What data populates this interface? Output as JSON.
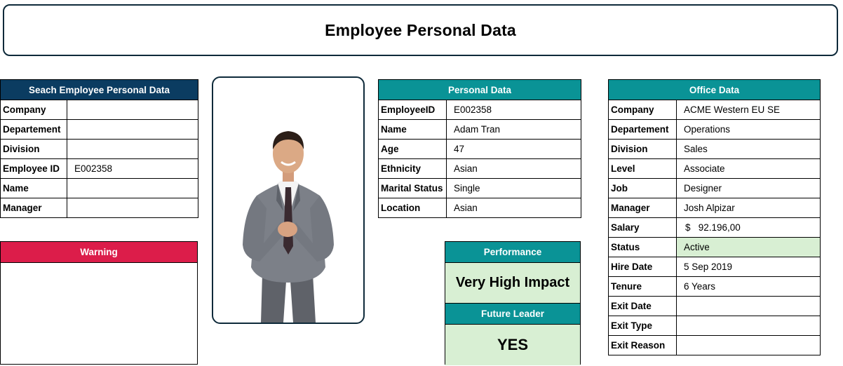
{
  "page_title": "Employee Personal Data",
  "search": {
    "header": "Seach Employee Personal Data",
    "rows": [
      {
        "label": "Company",
        "value": ""
      },
      {
        "label": "Departement",
        "value": ""
      },
      {
        "label": "Division",
        "value": ""
      },
      {
        "label": "Employee ID",
        "value": "E002358"
      },
      {
        "label": "Name",
        "value": ""
      },
      {
        "label": "Manager",
        "value": ""
      }
    ]
  },
  "warning": {
    "header": "Warning",
    "text": ""
  },
  "photo": {
    "icon": "employee-photo"
  },
  "personal": {
    "header": "Personal Data",
    "rows": [
      {
        "label": "EmployeeID",
        "value": "E002358"
      },
      {
        "label": "Name",
        "value": "Adam Tran"
      },
      {
        "label": "Age",
        "value": "47"
      },
      {
        "label": "Ethnicity",
        "value": "Asian"
      },
      {
        "label": "Marital Status",
        "value": "Single"
      },
      {
        "label": "Location",
        "value": "Asian"
      }
    ]
  },
  "performance": {
    "header": "Performance",
    "value": "Very High Impact"
  },
  "future_leader": {
    "header": "Future Leader",
    "value": "YES"
  },
  "office": {
    "header": "Office Data",
    "rows": [
      {
        "label": "Company",
        "value": "ACME Western EU SE"
      },
      {
        "label": "Departement",
        "value": "Operations"
      },
      {
        "label": "Division",
        "value": "Sales"
      },
      {
        "label": "Level",
        "value": "Associate"
      },
      {
        "label": "Job",
        "value": "Designer"
      },
      {
        "label": "Manager",
        "value": "Josh Alpizar"
      },
      {
        "label": "Salary",
        "value": "$   92.196,00"
      },
      {
        "label": "Status",
        "value": "Active"
      },
      {
        "label": "Hire Date",
        "value": "5 Sep 2019"
      },
      {
        "label": "Tenure",
        "value": "6 Years"
      },
      {
        "label": "Exit Date",
        "value": ""
      },
      {
        "label": "Exit Type",
        "value": ""
      },
      {
        "label": "Exit Reason",
        "value": ""
      }
    ]
  },
  "colors": {
    "navy": "#0b3c61",
    "teal": "#0a9396",
    "red": "#dc1d4a",
    "highlight": "#d8efd3"
  }
}
